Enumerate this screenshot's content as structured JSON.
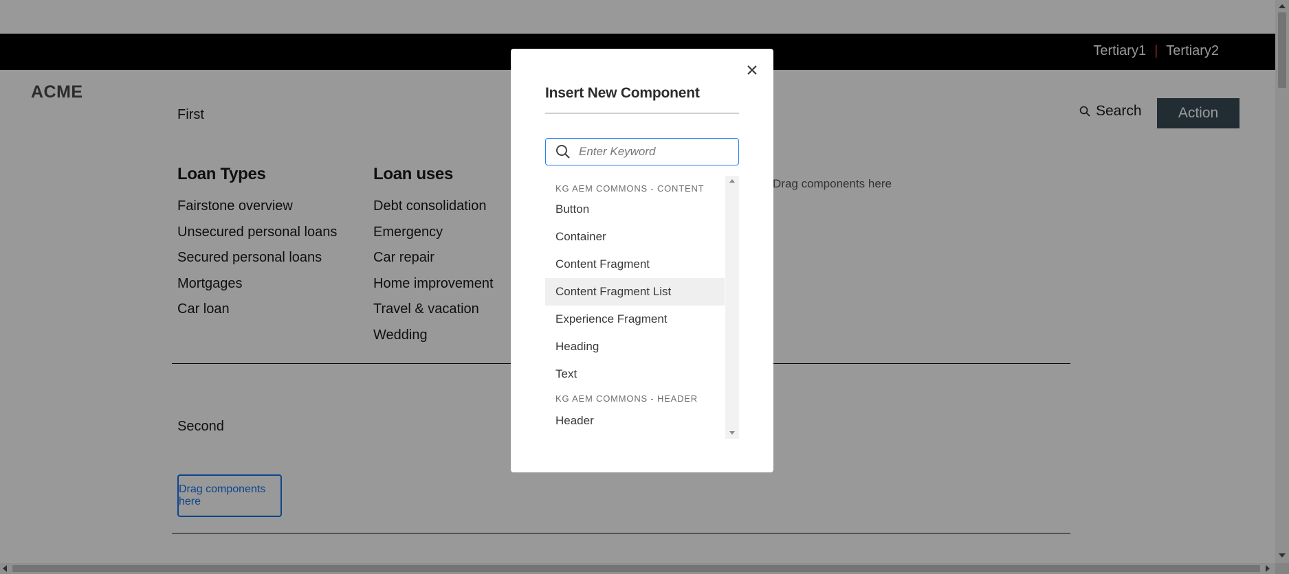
{
  "header": {
    "tertiary1": "Tertiary1",
    "separator": "|",
    "tertiary2": "Tertiary2",
    "logo": "ACME",
    "nav_first": "First",
    "search_label": "Search",
    "action_label": "Action"
  },
  "menu": {
    "col1": {
      "heading": "Loan Types",
      "items": [
        "Fairstone overview",
        "Unsecured personal loans",
        "Secured personal loans",
        "Mortgages",
        "Car loan"
      ]
    },
    "col2": {
      "heading": "Loan uses",
      "items": [
        "Debt consolidation",
        "Emergency",
        "Car repair",
        "Home improvement",
        "Travel & vacation",
        "Wedding"
      ]
    },
    "drag_right": "Drag components here"
  },
  "section2": {
    "nav_second": "Second",
    "drag_box": "Drag components here"
  },
  "dialog": {
    "title": "Insert New Component",
    "search_placeholder": "Enter Keyword",
    "groups": [
      {
        "label": "KG AEM COMMONS - CONTENT",
        "items": [
          "Button",
          "Container",
          "Content Fragment",
          "Content Fragment List",
          "Experience Fragment",
          "Heading",
          "Text"
        ]
      },
      {
        "label": "KG AEM COMMONS - HEADER",
        "items": [
          "Header"
        ]
      }
    ],
    "highlighted_item": "Content Fragment List"
  },
  "colors": {
    "topbar": "#000000",
    "accent_separator": "#e0403c",
    "action_button": "#3a4a55",
    "focus_blue": "#2680eb",
    "overlay": "rgba(0,0,0,0.4)"
  }
}
